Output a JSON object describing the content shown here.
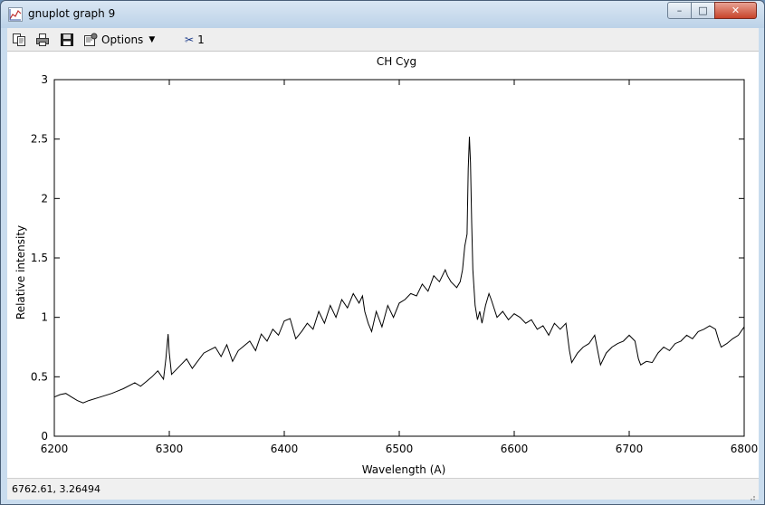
{
  "window": {
    "title": "gnuplot graph 9",
    "controls": {
      "minimize": "–",
      "maximize": "□",
      "close": "✕"
    }
  },
  "toolbar": {
    "icons": [
      "copy-icon",
      "print-icon",
      "save-icon"
    ],
    "options_label": "Options",
    "options_caret": "▼",
    "scissor_glyph": "✂",
    "scissor_count": "1"
  },
  "status": {
    "coordinates": "6762.61,  3.26494"
  },
  "chart_data": {
    "type": "line",
    "title": "CH Cyg",
    "xlabel": "Wavelength (A)",
    "ylabel": "Relative intensity",
    "xlim": [
      6200,
      6800
    ],
    "ylim": [
      0,
      3
    ],
    "xticks": [
      "6200",
      "6300",
      "6400",
      "6500",
      "6600",
      "6700",
      "6800"
    ],
    "yticks": [
      "0",
      "0.5",
      "1",
      "1.5",
      "2",
      "2.5",
      "3"
    ],
    "grid": false,
    "series": [
      {
        "color": "#000000",
        "x": [
          6200,
          6205,
          6210,
          6215,
          6220,
          6225,
          6230,
          6240,
          6250,
          6260,
          6270,
          6275,
          6280,
          6285,
          6290,
          6295,
          6297,
          6299,
          6300,
          6302,
          6305,
          6310,
          6315,
          6320,
          6330,
          6340,
          6345,
          6350,
          6355,
          6360,
          6370,
          6375,
          6380,
          6385,
          6390,
          6395,
          6400,
          6405,
          6410,
          6415,
          6420,
          6425,
          6430,
          6435,
          6440,
          6445,
          6450,
          6455,
          6460,
          6465,
          6468,
          6470,
          6473,
          6476,
          6480,
          6485,
          6490,
          6495,
          6500,
          6505,
          6510,
          6515,
          6520,
          6525,
          6530,
          6535,
          6540,
          6542,
          6545,
          6550,
          6553,
          6555,
          6557,
          6559,
          6560,
          6561,
          6562,
          6563,
          6564,
          6566,
          6568,
          6570,
          6572,
          6575,
          6578,
          6580,
          6585,
          6590,
          6595,
          6600,
          6605,
          6610,
          6615,
          6620,
          6625,
          6630,
          6635,
          6640,
          6645,
          6648,
          6650,
          6655,
          6660,
          6665,
          6670,
          6673,
          6675,
          6680,
          6685,
          6690,
          6695,
          6700,
          6705,
          6708,
          6710,
          6715,
          6720,
          6725,
          6730,
          6735,
          6740,
          6745,
          6750,
          6755,
          6760,
          6765,
          6770,
          6775,
          6778,
          6780,
          6785,
          6790,
          6795,
          6800
        ],
        "y": [
          0.33,
          0.35,
          0.36,
          0.33,
          0.3,
          0.28,
          0.3,
          0.33,
          0.36,
          0.4,
          0.45,
          0.42,
          0.46,
          0.5,
          0.55,
          0.48,
          0.65,
          0.86,
          0.7,
          0.52,
          0.55,
          0.6,
          0.65,
          0.57,
          0.7,
          0.75,
          0.67,
          0.77,
          0.63,
          0.72,
          0.8,
          0.72,
          0.86,
          0.8,
          0.9,
          0.85,
          0.97,
          0.99,
          0.82,
          0.88,
          0.95,
          0.9,
          1.05,
          0.95,
          1.1,
          1.0,
          1.15,
          1.08,
          1.2,
          1.12,
          1.18,
          1.05,
          0.95,
          0.88,
          1.05,
          0.92,
          1.1,
          1.0,
          1.12,
          1.15,
          1.2,
          1.18,
          1.28,
          1.22,
          1.35,
          1.3,
          1.4,
          1.35,
          1.3,
          1.25,
          1.3,
          1.4,
          1.6,
          1.7,
          2.25,
          2.52,
          2.3,
          1.8,
          1.4,
          1.1,
          0.98,
          1.05,
          0.95,
          1.1,
          1.2,
          1.15,
          1.0,
          1.05,
          0.98,
          1.03,
          1.0,
          0.95,
          0.98,
          0.9,
          0.93,
          0.85,
          0.95,
          0.9,
          0.95,
          0.72,
          0.62,
          0.7,
          0.75,
          0.78,
          0.85,
          0.7,
          0.6,
          0.7,
          0.75,
          0.78,
          0.8,
          0.85,
          0.8,
          0.65,
          0.6,
          0.63,
          0.62,
          0.7,
          0.75,
          0.72,
          0.78,
          0.8,
          0.85,
          0.82,
          0.88,
          0.9,
          0.93,
          0.9,
          0.8,
          0.75,
          0.78,
          0.82,
          0.85,
          0.92
        ]
      }
    ]
  }
}
